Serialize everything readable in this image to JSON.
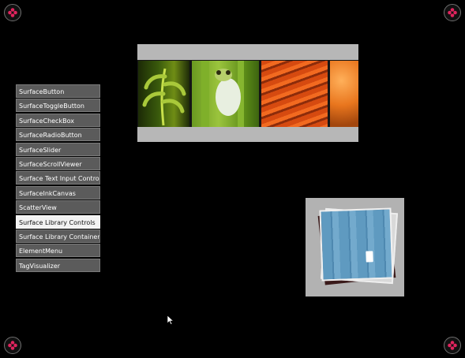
{
  "menu": {
    "items": [
      {
        "label": "SurfaceButton"
      },
      {
        "label": "SurfaceToggleButton"
      },
      {
        "label": "SurfaceCheckBox"
      },
      {
        "label": "SurfaceRadioButton"
      },
      {
        "label": "SurfaceSlider"
      },
      {
        "label": "SurfaceScrollViewer"
      },
      {
        "label": "Surface Text Input Controls"
      },
      {
        "label": "SurfaceInkCanvas"
      },
      {
        "label": "ScatterView"
      },
      {
        "label": "Surface Library Controls"
      },
      {
        "label": "Surface Library Containers"
      },
      {
        "label": "ElementMenu"
      },
      {
        "label": "TagVisualizer"
      }
    ],
    "selected_label": "Surface Library Controls"
  },
  "library_listbox": {
    "photos": [
      "fern",
      "frog",
      "stadium-seats",
      "cheese"
    ]
  },
  "library_stack": {
    "top_photo": "blue-door-tag"
  },
  "corners": {
    "icon": "access-point-icon",
    "accent_color": "#e0245e"
  },
  "colors": {
    "background": "#000000",
    "menu_item": "#5b5b5b",
    "menu_selected": "#f2f2f2",
    "container": "#b7b7b7"
  }
}
